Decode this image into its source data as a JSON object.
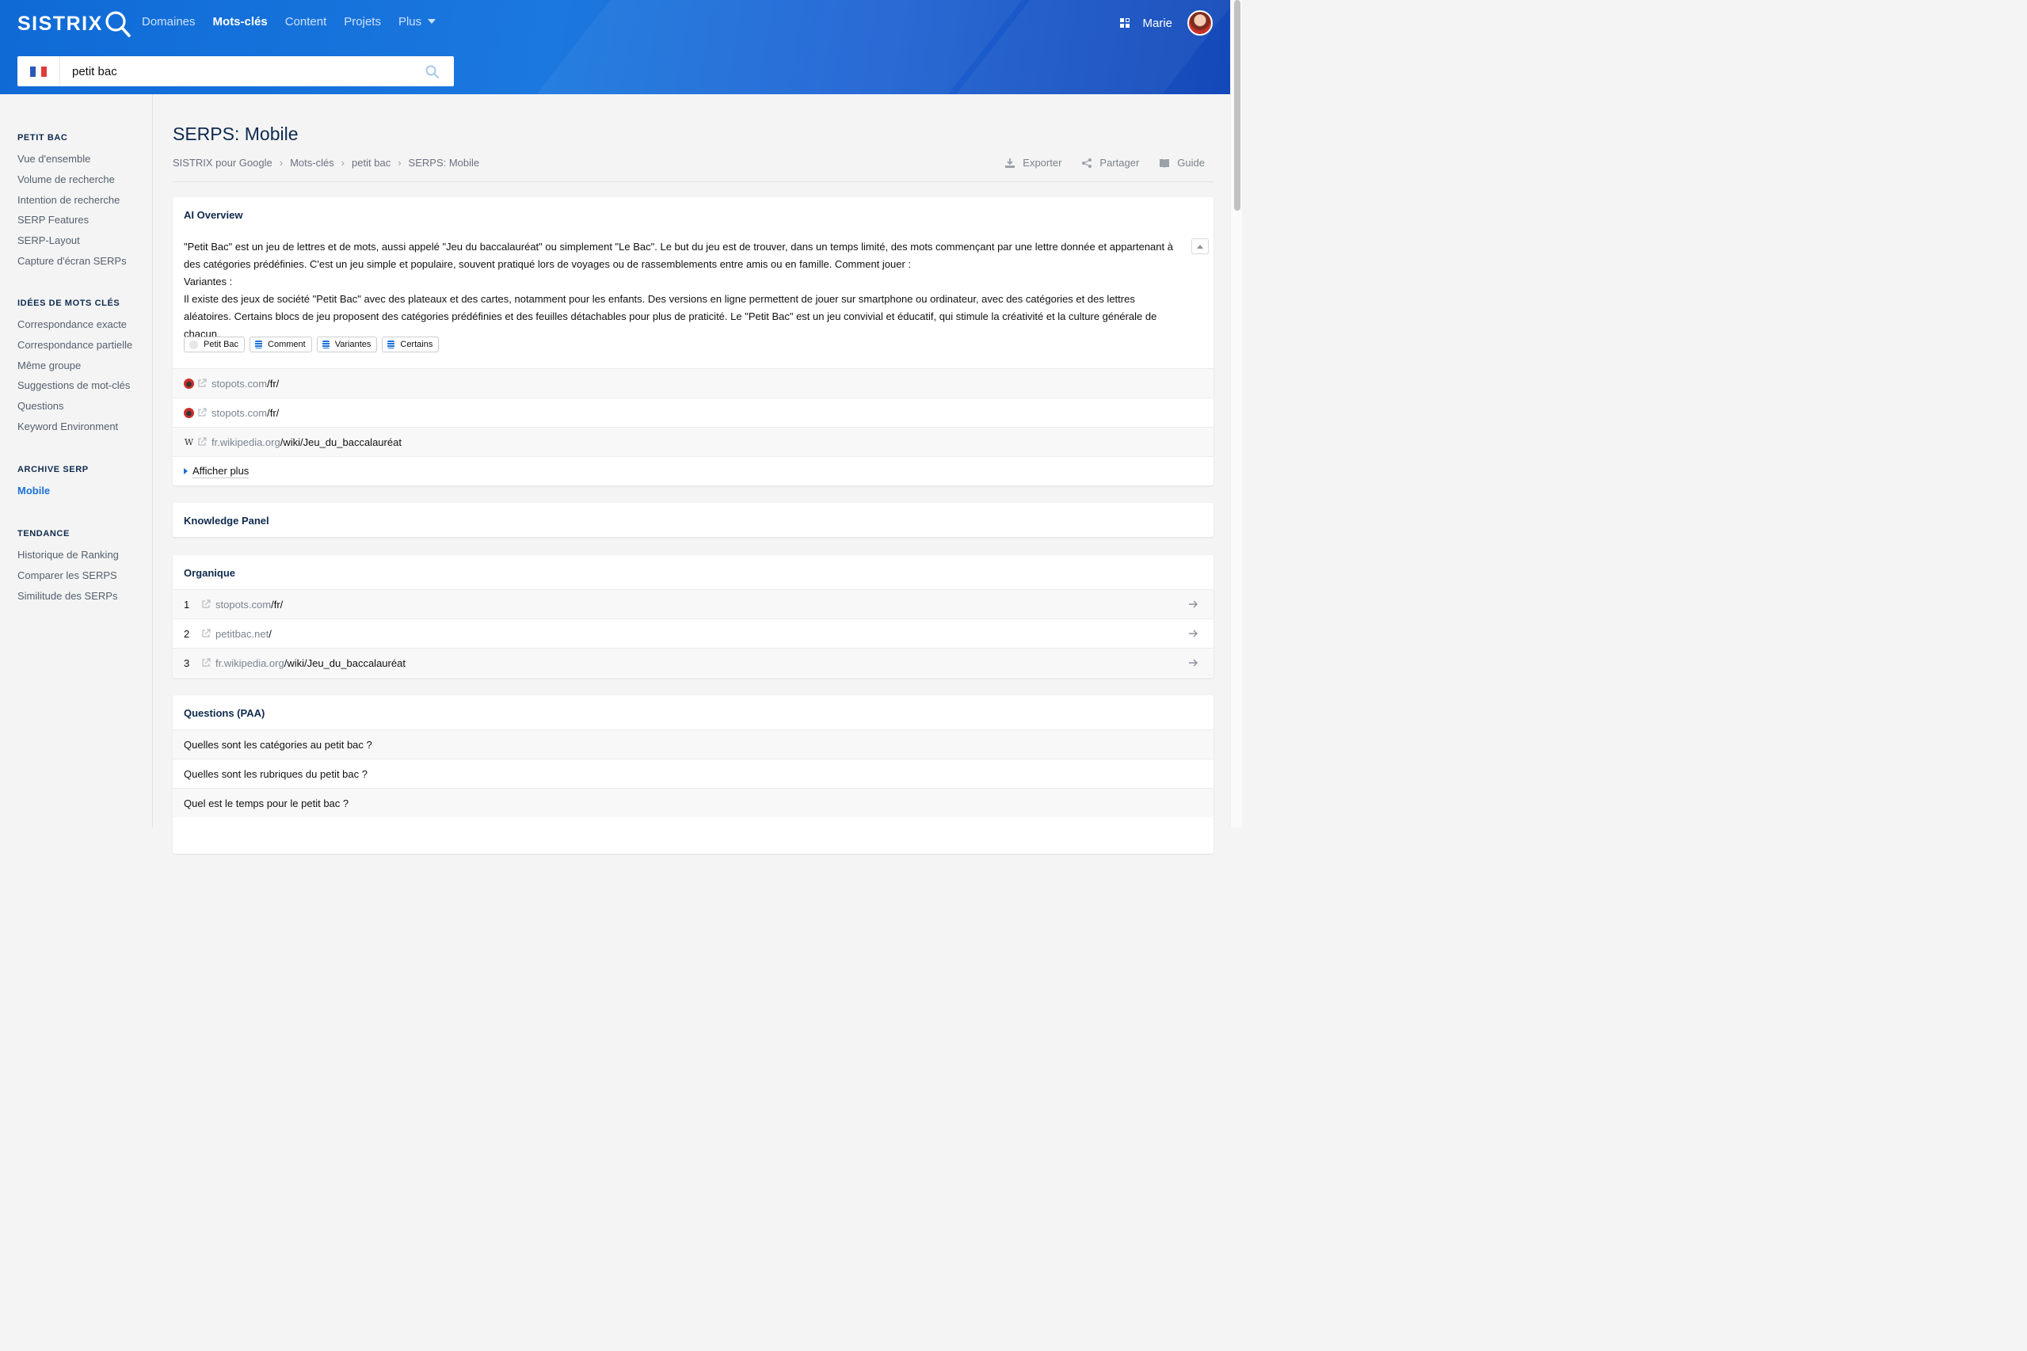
{
  "header": {
    "logo": "SISTRIX",
    "nav": [
      {
        "label": "Domaines",
        "active": false
      },
      {
        "label": "Mots-clés",
        "active": true
      },
      {
        "label": "Content",
        "active": false
      },
      {
        "label": "Projets",
        "active": false
      },
      {
        "label": "Plus",
        "active": false
      }
    ],
    "user_name": "Marie",
    "search_value": "petit bac",
    "search_country_flag": "FR",
    "colors": {
      "header_start": "#0f6ad6",
      "header_end": "#1448b8",
      "accent": "#1a6fd6"
    }
  },
  "sidebar": {
    "sections": [
      {
        "title": "PETIT BAC",
        "items": [
          "Vue d'ensemble",
          "Volume de recherche",
          "Intention de recherche",
          "SERP Features",
          "SERP-Layout",
          "Capture d'écran SERPs"
        ]
      },
      {
        "title": "IDÉES DE MOTS CLÉS",
        "items": [
          "Correspondance exacte",
          "Correspondance partielle",
          "Même groupe",
          "Suggestions de mot-clés",
          "Questions",
          "Keyword Environment"
        ]
      },
      {
        "title": "ARCHIVE SERP",
        "items": [
          "Mobile"
        ],
        "active": "Mobile"
      },
      {
        "title": "TENDANCE",
        "items": [
          "Historique de Ranking",
          "Comparer les SERPS",
          "Similitude des SERPs"
        ]
      }
    ]
  },
  "page": {
    "title": "SERPS: Mobile",
    "breadcrumb": [
      "SISTRIX pour Google",
      "Mots-clés",
      "petit bac",
      "SERPS: Mobile"
    ],
    "actions": {
      "export": "Exporter",
      "share": "Partager",
      "guide": "Guide"
    }
  },
  "ai_overview": {
    "title": "AI Overview",
    "paragraphs": [
      "\"Petit Bac\" est un jeu de lettres et de mots, aussi appelé \"Jeu du baccalauréat\" ou simplement \"Le Bac\". Le but du jeu est de trouver, dans un temps limité, des mots commençant par une lettre donnée et appartenant à des catégories prédéfinies. C'est un jeu simple et populaire, souvent pratiqué lors de voyages ou de rassemblements entre amis ou en famille. Comment jouer :",
      "Variantes :",
      "Il existe des jeux de société \"Petit Bac\" avec des plateaux et des cartes, notamment pour les enfants.  Des versions en ligne permettent de jouer sur smartphone ou ordinateur, avec des catégories et des lettres aléatoires. Certains blocs de jeu proposent des catégories prédéfinies et des feuilles détachables pour plus de praticité.  Le \"Petit Bac\" est un jeu convivial et éducatif, qui stimule la créativité et la culture générale de chacun."
    ],
    "chips": [
      "Petit Bac",
      "Comment",
      "Variantes",
      "Certains"
    ],
    "sources": [
      {
        "host": "stopots.com",
        "path": "/fr/",
        "favicon": "stopots-icon"
      },
      {
        "host": "stopots.com",
        "path": "/fr/",
        "favicon": "stopots-icon"
      },
      {
        "host": "fr.wikipedia.org",
        "path": "/wiki/Jeu_du_baccalauréat",
        "favicon": "wikipedia-icon"
      }
    ],
    "show_more": "Afficher plus"
  },
  "knowledge_panel": {
    "title": "Knowledge Panel"
  },
  "organic": {
    "title": "Organique",
    "results": [
      {
        "rank": "1",
        "host": "stopots.com",
        "path": "/fr/"
      },
      {
        "rank": "2",
        "host": "petitbac.net",
        "path": "/"
      },
      {
        "rank": "3",
        "host": "fr.wikipedia.org",
        "path": "/wiki/Jeu_du_baccalauréat"
      }
    ]
  },
  "paa": {
    "title": "Questions (PAA)",
    "questions": [
      "Quelles sont les catégories au petit bac ?",
      "Quelles sont les rubriques du petit bac ?",
      "Quel est le temps pour le petit bac ?"
    ]
  }
}
